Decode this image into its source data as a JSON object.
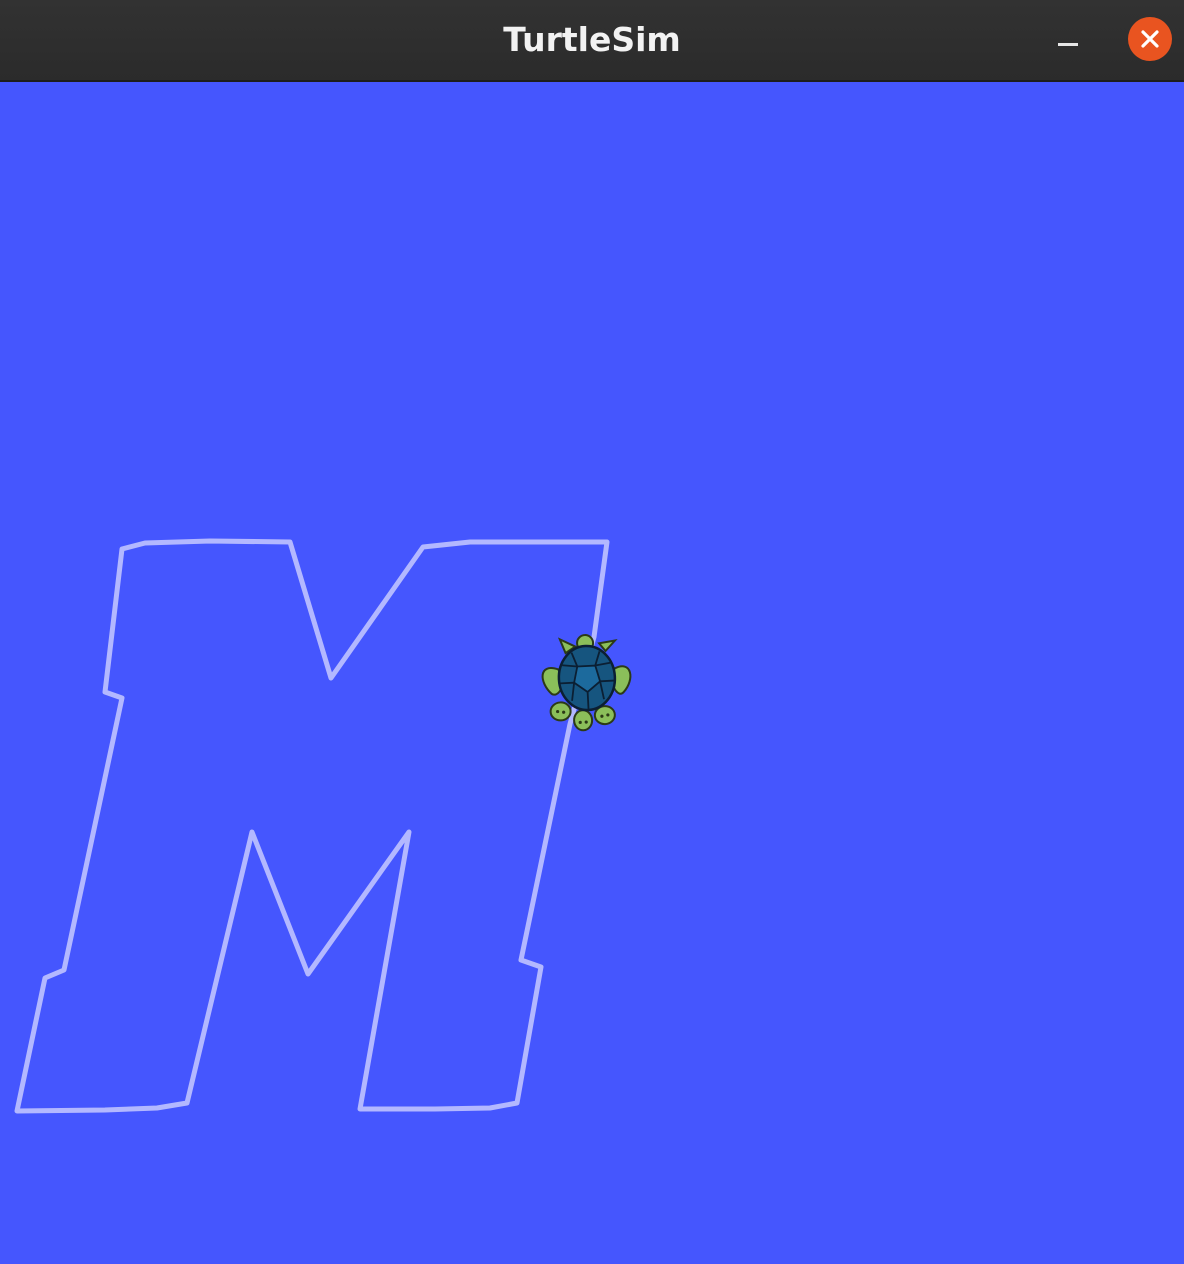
{
  "window": {
    "title": "TurtleSim",
    "minimize_icon": "minimize-icon",
    "close_icon": "close-icon"
  },
  "canvas": {
    "background_color": "#4556fe",
    "pen_color": "#b3b8ff",
    "turtle_icon": "turtle-icon"
  }
}
